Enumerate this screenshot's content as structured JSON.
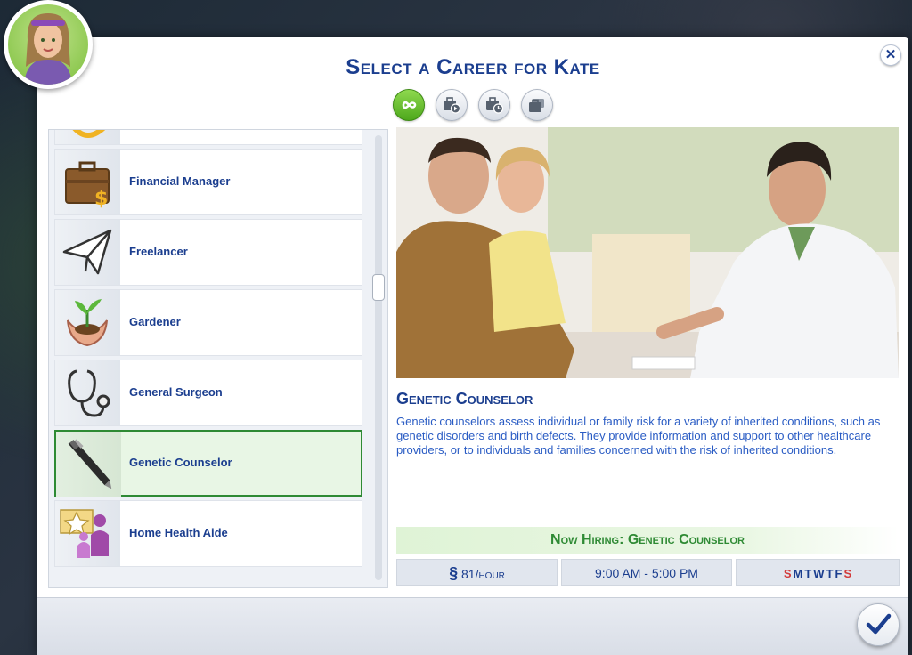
{
  "dialog": {
    "title": "Select a Career for Kate",
    "close_label": "✕"
  },
  "tabs": [
    {
      "name": "all-careers",
      "icon": "infinity-icon",
      "active": true
    },
    {
      "name": "full-time",
      "icon": "briefcase-play-icon",
      "active": false
    },
    {
      "name": "part-time",
      "icon": "briefcase-clock-icon",
      "active": false
    },
    {
      "name": "freelance",
      "icon": "briefcase-stack-icon",
      "active": false
    }
  ],
  "careers": [
    {
      "label": "",
      "icon": "partial-icon"
    },
    {
      "label": "Financial Manager",
      "icon": "briefcase-money-icon"
    },
    {
      "label": "Freelancer",
      "icon": "paper-plane-icon"
    },
    {
      "label": "Gardener",
      "icon": "plant-hands-icon"
    },
    {
      "label": "General Surgeon",
      "icon": "stethoscope-icon"
    },
    {
      "label": "Genetic Counselor",
      "icon": "pen-icon",
      "selected": true
    },
    {
      "label": "Home Health Aide",
      "icon": "star-people-icon"
    }
  ],
  "detail": {
    "title": "Genetic Counselor",
    "description": "Genetic counselors assess individual or family risk for a variety of inherited conditions, such as genetic disorders and birth defects. They provide information and support to other healthcare providers, or to individuals and families concerned with the risk of inherited conditions.",
    "hiring": "Now Hiring: Genetic Counselor",
    "pay_symbol": "§",
    "pay_amount": "81",
    "pay_unit": "/hour",
    "hours": "9:00  AM - 5:00  PM",
    "days": [
      "S",
      "M",
      "T",
      "W",
      "T",
      "F",
      "S"
    ]
  },
  "colors": {
    "accent": "#1b3e8f",
    "link": "#2a5cc4",
    "hiring": "#2e8a34",
    "weekend": "#d23a3a"
  }
}
